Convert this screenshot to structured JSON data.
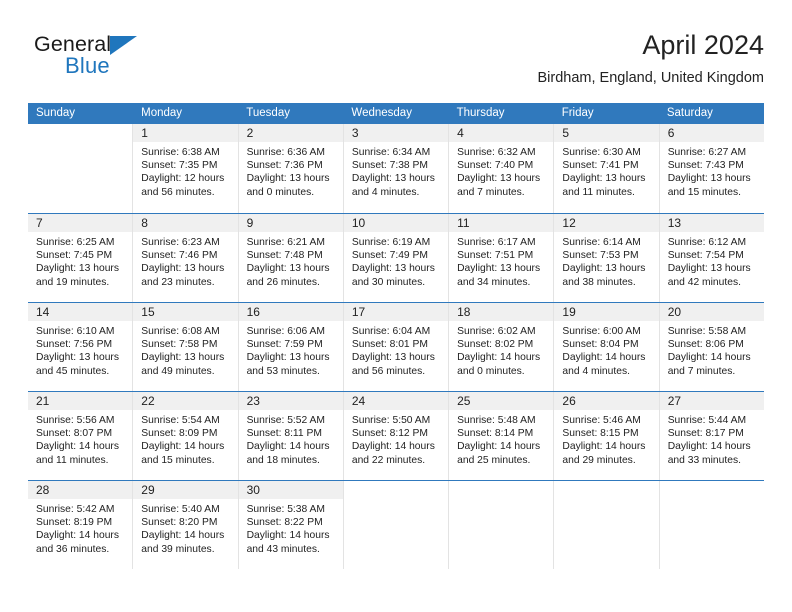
{
  "brand": {
    "name_dark": "General",
    "name_blue": "Blue",
    "accent_color": "#1f76bd"
  },
  "header": {
    "title": "April 2024",
    "subtitle": "Birdham, England, United Kingdom"
  },
  "calendar": {
    "header_bg": "#3079bd",
    "daynum_bg": "#f0f0f0",
    "weekdays": [
      "Sunday",
      "Monday",
      "Tuesday",
      "Wednesday",
      "Thursday",
      "Friday",
      "Saturday"
    ],
    "weeks": [
      [
        {
          "day": "",
          "lines": []
        },
        {
          "day": "1",
          "lines": [
            "Sunrise: 6:38 AM",
            "Sunset: 7:35 PM",
            "Daylight: 12 hours",
            "and 56 minutes."
          ]
        },
        {
          "day": "2",
          "lines": [
            "Sunrise: 6:36 AM",
            "Sunset: 7:36 PM",
            "Daylight: 13 hours",
            "and 0 minutes."
          ]
        },
        {
          "day": "3",
          "lines": [
            "Sunrise: 6:34 AM",
            "Sunset: 7:38 PM",
            "Daylight: 13 hours",
            "and 4 minutes."
          ]
        },
        {
          "day": "4",
          "lines": [
            "Sunrise: 6:32 AM",
            "Sunset: 7:40 PM",
            "Daylight: 13 hours",
            "and 7 minutes."
          ]
        },
        {
          "day": "5",
          "lines": [
            "Sunrise: 6:30 AM",
            "Sunset: 7:41 PM",
            "Daylight: 13 hours",
            "and 11 minutes."
          ]
        },
        {
          "day": "6",
          "lines": [
            "Sunrise: 6:27 AM",
            "Sunset: 7:43 PM",
            "Daylight: 13 hours",
            "and 15 minutes."
          ]
        }
      ],
      [
        {
          "day": "7",
          "lines": [
            "Sunrise: 6:25 AM",
            "Sunset: 7:45 PM",
            "Daylight: 13 hours",
            "and 19 minutes."
          ]
        },
        {
          "day": "8",
          "lines": [
            "Sunrise: 6:23 AM",
            "Sunset: 7:46 PM",
            "Daylight: 13 hours",
            "and 23 minutes."
          ]
        },
        {
          "day": "9",
          "lines": [
            "Sunrise: 6:21 AM",
            "Sunset: 7:48 PM",
            "Daylight: 13 hours",
            "and 26 minutes."
          ]
        },
        {
          "day": "10",
          "lines": [
            "Sunrise: 6:19 AM",
            "Sunset: 7:49 PM",
            "Daylight: 13 hours",
            "and 30 minutes."
          ]
        },
        {
          "day": "11",
          "lines": [
            "Sunrise: 6:17 AM",
            "Sunset: 7:51 PM",
            "Daylight: 13 hours",
            "and 34 minutes."
          ]
        },
        {
          "day": "12",
          "lines": [
            "Sunrise: 6:14 AM",
            "Sunset: 7:53 PM",
            "Daylight: 13 hours",
            "and 38 minutes."
          ]
        },
        {
          "day": "13",
          "lines": [
            "Sunrise: 6:12 AM",
            "Sunset: 7:54 PM",
            "Daylight: 13 hours",
            "and 42 minutes."
          ]
        }
      ],
      [
        {
          "day": "14",
          "lines": [
            "Sunrise: 6:10 AM",
            "Sunset: 7:56 PM",
            "Daylight: 13 hours",
            "and 45 minutes."
          ]
        },
        {
          "day": "15",
          "lines": [
            "Sunrise: 6:08 AM",
            "Sunset: 7:58 PM",
            "Daylight: 13 hours",
            "and 49 minutes."
          ]
        },
        {
          "day": "16",
          "lines": [
            "Sunrise: 6:06 AM",
            "Sunset: 7:59 PM",
            "Daylight: 13 hours",
            "and 53 minutes."
          ]
        },
        {
          "day": "17",
          "lines": [
            "Sunrise: 6:04 AM",
            "Sunset: 8:01 PM",
            "Daylight: 13 hours",
            "and 56 minutes."
          ]
        },
        {
          "day": "18",
          "lines": [
            "Sunrise: 6:02 AM",
            "Sunset: 8:02 PM",
            "Daylight: 14 hours",
            "and 0 minutes."
          ]
        },
        {
          "day": "19",
          "lines": [
            "Sunrise: 6:00 AM",
            "Sunset: 8:04 PM",
            "Daylight: 14 hours",
            "and 4 minutes."
          ]
        },
        {
          "day": "20",
          "lines": [
            "Sunrise: 5:58 AM",
            "Sunset: 8:06 PM",
            "Daylight: 14 hours",
            "and 7 minutes."
          ]
        }
      ],
      [
        {
          "day": "21",
          "lines": [
            "Sunrise: 5:56 AM",
            "Sunset: 8:07 PM",
            "Daylight: 14 hours",
            "and 11 minutes."
          ]
        },
        {
          "day": "22",
          "lines": [
            "Sunrise: 5:54 AM",
            "Sunset: 8:09 PM",
            "Daylight: 14 hours",
            "and 15 minutes."
          ]
        },
        {
          "day": "23",
          "lines": [
            "Sunrise: 5:52 AM",
            "Sunset: 8:11 PM",
            "Daylight: 14 hours",
            "and 18 minutes."
          ]
        },
        {
          "day": "24",
          "lines": [
            "Sunrise: 5:50 AM",
            "Sunset: 8:12 PM",
            "Daylight: 14 hours",
            "and 22 minutes."
          ]
        },
        {
          "day": "25",
          "lines": [
            "Sunrise: 5:48 AM",
            "Sunset: 8:14 PM",
            "Daylight: 14 hours",
            "and 25 minutes."
          ]
        },
        {
          "day": "26",
          "lines": [
            "Sunrise: 5:46 AM",
            "Sunset: 8:15 PM",
            "Daylight: 14 hours",
            "and 29 minutes."
          ]
        },
        {
          "day": "27",
          "lines": [
            "Sunrise: 5:44 AM",
            "Sunset: 8:17 PM",
            "Daylight: 14 hours",
            "and 33 minutes."
          ]
        }
      ],
      [
        {
          "day": "28",
          "lines": [
            "Sunrise: 5:42 AM",
            "Sunset: 8:19 PM",
            "Daylight: 14 hours",
            "and 36 minutes."
          ]
        },
        {
          "day": "29",
          "lines": [
            "Sunrise: 5:40 AM",
            "Sunset: 8:20 PM",
            "Daylight: 14 hours",
            "and 39 minutes."
          ]
        },
        {
          "day": "30",
          "lines": [
            "Sunrise: 5:38 AM",
            "Sunset: 8:22 PM",
            "Daylight: 14 hours",
            "and 43 minutes."
          ]
        },
        {
          "day": "",
          "lines": []
        },
        {
          "day": "",
          "lines": []
        },
        {
          "day": "",
          "lines": []
        },
        {
          "day": "",
          "lines": []
        }
      ]
    ]
  }
}
